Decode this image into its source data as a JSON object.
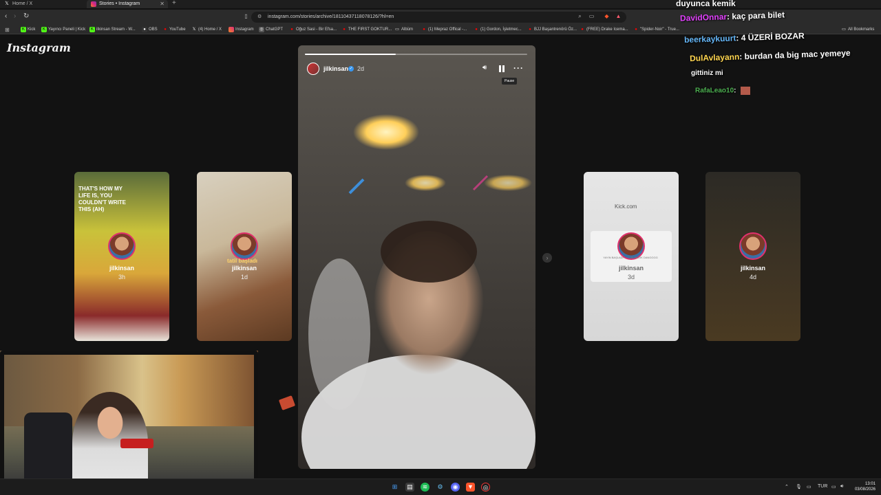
{
  "browser": {
    "tabs": [
      {
        "title": "Home / X",
        "icon": "x-logo-icon"
      },
      {
        "title": "Stories • Instagram",
        "icon": "instagram-icon"
      }
    ],
    "new_tab": "+",
    "url": "instagram.com/stories/archive/18110437118078126/?hl=en",
    "bookmarks": [
      "Kick",
      "Yayıncı Paneli | Kick",
      "ilkinsan Stream - W...",
      "OBS",
      "YouTube",
      "(4) Home / X",
      "Instagram",
      "ChatGPT",
      "Oğuz Sasi - Bir Efsa...",
      "THE FIRST GOKTUR...",
      "Albüm",
      "(1) Mepraz Offical -...",
      "(1) Gordon, İşletmec...",
      "BJJ Başantrenörü Öz...",
      "(FREE) Drake Icema...",
      "\"Spider-Noir\" - True..."
    ],
    "all_bookmarks": "All Bookmarks"
  },
  "instagram": {
    "logo": "Instagram",
    "story": {
      "username": "jilkinsan",
      "time": "2d",
      "tooltip": "Pause",
      "progress": 0.41
    },
    "side_stories": [
      {
        "username": "jilkinsan",
        "time": "3h",
        "quote": "THAT'S HOW MY LIFE IS, YOU COULDN'T WRITE THIS (AH)"
      },
      {
        "username": "jilkinsan",
        "time": "1d",
        "overlay": "tatil başladı"
      },
      {
        "username": "jilkinsan",
        "time": "3d",
        "site": "Kick.com",
        "card_text": "YAYIN BAŞLADI ... TOPLANDIK DANGGGG"
      },
      {
        "username": "jilkinsan",
        "time": "4d"
      }
    ]
  },
  "chat": [
    {
      "user": "",
      "text": "duyunca kemik"
    },
    {
      "user": "DavidOnnar",
      "text": "kaç para bilet"
    },
    {
      "user": "beerkaykuurt",
      "text": "4 ÜZERİ BOZAR"
    },
    {
      "user": "DulAvlayann",
      "text": "burdan da big mac yemeye"
    },
    {
      "user": "",
      "text": "gittiniz mi"
    },
    {
      "user": "RafaLeao10",
      "text": ""
    }
  ],
  "colors": {
    "chat_user_1": "#e040fb",
    "chat_user_2": "#64b5f6",
    "chat_user_3": "#ffd54f",
    "chat_user_4": "#4caf50"
  },
  "taskbar": {
    "language": "TUR",
    "time": "13:01",
    "date": "03/08/2026"
  }
}
